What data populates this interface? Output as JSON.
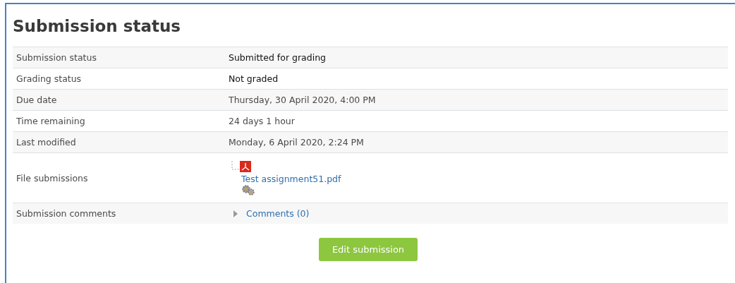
{
  "heading": "Submission status",
  "rows": [
    {
      "kind": "text",
      "label": "Submission status",
      "value": "Submitted for grading",
      "emphasis": true
    },
    {
      "kind": "text",
      "label": "Grading status",
      "value": "Not graded",
      "emphasis": true
    },
    {
      "kind": "text",
      "label": "Due date",
      "value": "Thursday, 30 April 2020, 4:00 PM",
      "emphasis": false
    },
    {
      "kind": "text",
      "label": "Time remaining",
      "value": "24 days 1 hour",
      "emphasis": false
    },
    {
      "kind": "text",
      "label": "Last modified",
      "value": "Monday, 6 April 2020, 2:24 PM",
      "emphasis": false
    },
    {
      "kind": "files",
      "label": "File submissions",
      "file": "Test assignment51.pdf"
    },
    {
      "kind": "comments",
      "label": "Submission comments",
      "link": "Comments (0)",
      "expanded": false
    }
  ],
  "button": "Edit submission"
}
